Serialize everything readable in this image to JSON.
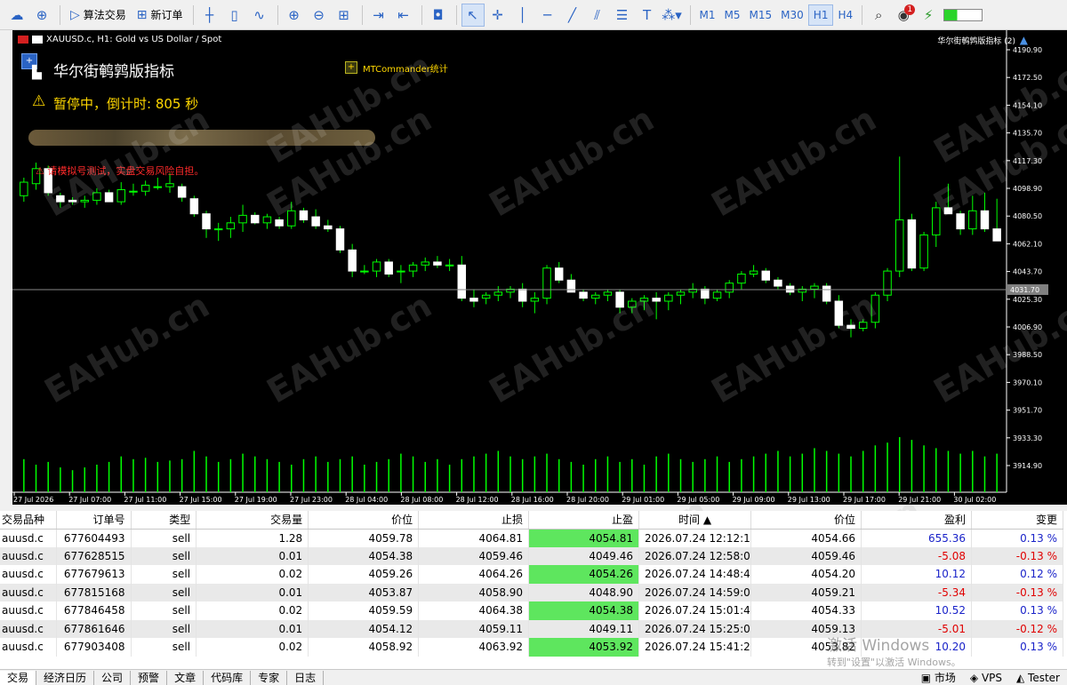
{
  "toolbar": {
    "algo_trading": "算法交易",
    "new_order": "新订单",
    "timeframes": [
      "M1",
      "M5",
      "M15",
      "M30",
      "H1",
      "H4"
    ],
    "active_timeframe": "H1",
    "notification_count": "1"
  },
  "chart": {
    "symbol_line": "XAUUSD.c, H1:  Gold vs US Dollar / Spot",
    "indicator_title": "华尔街鹌鹑版指标",
    "pause_status": "暂停中，倒计时: 805 秒",
    "commander_label": "MTCommander统计",
    "warning_text": "请模拟号测试，实盘交易风险自担。",
    "top_right_label": "华尔街鹌鹑版指标 (2)",
    "current_price": "4031.70",
    "price_axis": [
      "4190.90",
      "4172.50",
      "4154.10",
      "4135.70",
      "4117.30",
      "4098.90",
      "4080.50",
      "4062.10",
      "4043.70",
      "4025.30",
      "4006.90",
      "3988.50",
      "3970.10",
      "3951.70",
      "3933.30",
      "3914.90"
    ],
    "time_axis": [
      "27 Jul 2026",
      "27 Jul 07:00",
      "27 Jul 11:00",
      "27 Jul 15:00",
      "27 Jul 19:00",
      "27 Jul 23:00",
      "28 Jul 04:00",
      "28 Jul 08:00",
      "28 Jul 12:00",
      "28 Jul 16:00",
      "28 Jul 20:00",
      "29 Jul 01:00",
      "29 Jul 05:00",
      "29 Jul 09:00",
      "29 Jul 13:00",
      "29 Jul 17:00",
      "29 Jul 21:00",
      "30 Jul 02:00"
    ],
    "watermark": "EAHub.cn",
    "colors": {
      "background": "#000000",
      "bull": "#00ff00",
      "bear": "#ffffff",
      "volume": "#00ff00",
      "text": "#ffffff",
      "warning": "#ff2a2a",
      "pause": "#ffd700"
    }
  },
  "chart_data": {
    "type": "candlestick",
    "ylim": [
      3905,
      4200
    ],
    "candles": [
      [
        4094,
        4106,
        4090,
        4103
      ],
      [
        4102,
        4116,
        4098,
        4112
      ],
      [
        4112,
        4114,
        4094,
        4096
      ],
      [
        4094,
        4096,
        4086,
        4090
      ],
      [
        4091,
        4093,
        4088,
        4090
      ],
      [
        4090,
        4094,
        4086,
        4091
      ],
      [
        4091,
        4099,
        4088,
        4096
      ],
      [
        4096,
        4098,
        4090,
        4090
      ],
      [
        4090,
        4103,
        4088,
        4098
      ],
      [
        4097,
        4102,
        4094,
        4097
      ],
      [
        4097,
        4104,
        4094,
        4101
      ],
      [
        4100,
        4106,
        4098,
        4100
      ],
      [
        4100,
        4109,
        4096,
        4102
      ],
      [
        4100,
        4102,
        4090,
        4093
      ],
      [
        4092,
        4094,
        4080,
        4082
      ],
      [
        4082,
        4084,
        4066,
        4072
      ],
      [
        4072,
        4076,
        4064,
        4072
      ],
      [
        4072,
        4080,
        4066,
        4076
      ],
      [
        4076,
        4088,
        4070,
        4081
      ],
      [
        4081,
        4083,
        4075,
        4076
      ],
      [
        4076,
        4082,
        4072,
        4080
      ],
      [
        4078,
        4080,
        4072,
        4074
      ],
      [
        4074,
        4090,
        4072,
        4084
      ],
      [
        4084,
        4086,
        4076,
        4078
      ],
      [
        4080,
        4085,
        4072,
        4074
      ],
      [
        4074,
        4078,
        4070,
        4072
      ],
      [
        4072,
        4074,
        4056,
        4058
      ],
      [
        4058,
        4062,
        4040,
        4044
      ],
      [
        4044,
        4048,
        4042,
        4044
      ],
      [
        4044,
        4052,
        4040,
        4050
      ],
      [
        4050,
        4052,
        4040,
        4042
      ],
      [
        4044,
        4048,
        4036,
        4044
      ],
      [
        4044,
        4050,
        4040,
        4048
      ],
      [
        4048,
        4053,
        4044,
        4050
      ],
      [
        4050,
        4054,
        4046,
        4048
      ],
      [
        4048,
        4052,
        4044,
        4048
      ],
      [
        4048,
        4054,
        4024,
        4026
      ],
      [
        4026,
        4032,
        4020,
        4024
      ],
      [
        4026,
        4030,
        4022,
        4028
      ],
      [
        4028,
        4034,
        4024,
        4030
      ],
      [
        4030,
        4034,
        4026,
        4032
      ],
      [
        4032,
        4036,
        4020,
        4024
      ],
      [
        4024,
        4030,
        4016,
        4026
      ],
      [
        4026,
        4048,
        4022,
        4046
      ],
      [
        4046,
        4050,
        4036,
        4038
      ],
      [
        4038,
        4042,
        4030,
        4030
      ],
      [
        4030,
        4032,
        4024,
        4026
      ],
      [
        4026,
        4030,
        4022,
        4028
      ],
      [
        4028,
        4032,
        4024,
        4030
      ],
      [
        4030,
        4032,
        4016,
        4020
      ],
      [
        4020,
        4026,
        4016,
        4024
      ],
      [
        4024,
        4028,
        4018,
        4026
      ],
      [
        4026,
        4030,
        4012,
        4024
      ],
      [
        4024,
        4030,
        4018,
        4028
      ],
      [
        4028,
        4032,
        4022,
        4030
      ],
      [
        4030,
        4036,
        4026,
        4032
      ],
      [
        4032,
        4034,
        4022,
        4026
      ],
      [
        4026,
        4032,
        4024,
        4030
      ],
      [
        4030,
        4038,
        4026,
        4036
      ],
      [
        4036,
        4044,
        4032,
        4042
      ],
      [
        4042,
        4048,
        4040,
        4044
      ],
      [
        4044,
        4046,
        4036,
        4038
      ],
      [
        4038,
        4040,
        4032,
        4034
      ],
      [
        4034,
        4036,
        4028,
        4030
      ],
      [
        4030,
        4034,
        4024,
        4032
      ],
      [
        4032,
        4036,
        4026,
        4034
      ],
      [
        4034,
        4036,
        4022,
        4024
      ],
      [
        4024,
        4028,
        4006,
        4008
      ],
      [
        4008,
        4012,
        4000,
        4006
      ],
      [
        4006,
        4012,
        4004,
        4010
      ],
      [
        4010,
        4030,
        4006,
        4028
      ],
      [
        4028,
        4046,
        4024,
        4044
      ],
      [
        4044,
        4120,
        4040,
        4078
      ],
      [
        4078,
        4082,
        4044,
        4046
      ],
      [
        4046,
        4070,
        4044,
        4068
      ],
      [
        4068,
        4090,
        4060,
        4086
      ],
      [
        4086,
        4102,
        4082,
        4082
      ],
      [
        4082,
        4084,
        4068,
        4072
      ],
      [
        4072,
        4094,
        4068,
        4084
      ],
      [
        4084,
        4096,
        4070,
        4072
      ],
      [
        4072,
        4092,
        4064,
        4064
      ]
    ],
    "volume": [
      24,
      20,
      22,
      18,
      16,
      18,
      20,
      22,
      26,
      24,
      25,
      22,
      23,
      24,
      30,
      26,
      22,
      24,
      28,
      26,
      24,
      22,
      20,
      24,
      26,
      22,
      24,
      26,
      20,
      22,
      24,
      28,
      26,
      22,
      24,
      20,
      24,
      26,
      28,
      30,
      26,
      24,
      26,
      28,
      24,
      22,
      20,
      24,
      26,
      22,
      24,
      20,
      26,
      28,
      24,
      22,
      24,
      26,
      22,
      24,
      26,
      28,
      30,
      26,
      28,
      32,
      30,
      28,
      26,
      30,
      34,
      36,
      40,
      38,
      34,
      32,
      30,
      28,
      30,
      26,
      28
    ]
  },
  "grid": {
    "columns": [
      "交易品种",
      "订单号",
      "类型",
      "交易量",
      "价位",
      "止损",
      "止盈",
      "时间 ▲",
      "价位",
      "盈利",
      "变更"
    ],
    "rows": [
      {
        "symbol": "auusd.c",
        "ticket": "677604493",
        "type": "sell",
        "volume": "1.28",
        "open": "4059.78",
        "sl": "4064.81",
        "tp": "4054.81",
        "time": "2026.07.24 12:12:10",
        "price": "4054.66",
        "profit": "655.36",
        "change": "0.13 %",
        "sl_hit": false,
        "tp_hit": true,
        "positive": true
      },
      {
        "symbol": "auusd.c",
        "ticket": "677628515",
        "type": "sell",
        "volume": "0.01",
        "open": "4054.38",
        "sl": "4059.46",
        "tp": "4049.46",
        "time": "2026.07.24 12:58:06",
        "price": "4059.46",
        "profit": "-5.08",
        "change": "-0.13 %",
        "sl_hit": true,
        "tp_hit": false,
        "positive": false
      },
      {
        "symbol": "auusd.c",
        "ticket": "677679613",
        "type": "sell",
        "volume": "0.02",
        "open": "4059.26",
        "sl": "4064.26",
        "tp": "4054.26",
        "time": "2026.07.24 14:48:43",
        "price": "4054.20",
        "profit": "10.12",
        "change": "0.12 %",
        "sl_hit": false,
        "tp_hit": true,
        "positive": true
      },
      {
        "symbol": "auusd.c",
        "ticket": "677815168",
        "type": "sell",
        "volume": "0.01",
        "open": "4053.87",
        "sl": "4058.90",
        "tp": "4048.90",
        "time": "2026.07.24 14:59:07",
        "price": "4059.21",
        "profit": "-5.34",
        "change": "-0.13 %",
        "sl_hit": true,
        "tp_hit": false,
        "positive": false
      },
      {
        "symbol": "auusd.c",
        "ticket": "677846458",
        "type": "sell",
        "volume": "0.02",
        "open": "4059.59",
        "sl": "4064.38",
        "tp": "4054.38",
        "time": "2026.07.24 15:01:43",
        "price": "4054.33",
        "profit": "10.52",
        "change": "0.13 %",
        "sl_hit": false,
        "tp_hit": true,
        "positive": true
      },
      {
        "symbol": "auusd.c",
        "ticket": "677861646",
        "type": "sell",
        "volume": "0.01",
        "open": "4054.12",
        "sl": "4059.11",
        "tp": "4049.11",
        "time": "2026.07.24 15:25:04",
        "price": "4059.13",
        "profit": "-5.01",
        "change": "-0.12 %",
        "sl_hit": true,
        "tp_hit": false,
        "positive": false
      },
      {
        "symbol": "auusd.c",
        "ticket": "677903408",
        "type": "sell",
        "volume": "0.02",
        "open": "4058.92",
        "sl": "4063.92",
        "tp": "4053.92",
        "time": "2026.07.24 15:41:28",
        "price": "4053.82",
        "profit": "10.20",
        "change": "0.13 %",
        "sl_hit": false,
        "tp_hit": true,
        "positive": true
      }
    ]
  },
  "bottom_tabs": [
    "交易",
    "经济日历",
    "公司",
    "预警",
    "文章",
    "代码库",
    "专家",
    "日志"
  ],
  "status_right": [
    "市场",
    "VPS",
    "Tester"
  ],
  "windows_activation": {
    "line1": "激活 Windows",
    "line2": "转到\"设置\"以激活 Windows。"
  }
}
